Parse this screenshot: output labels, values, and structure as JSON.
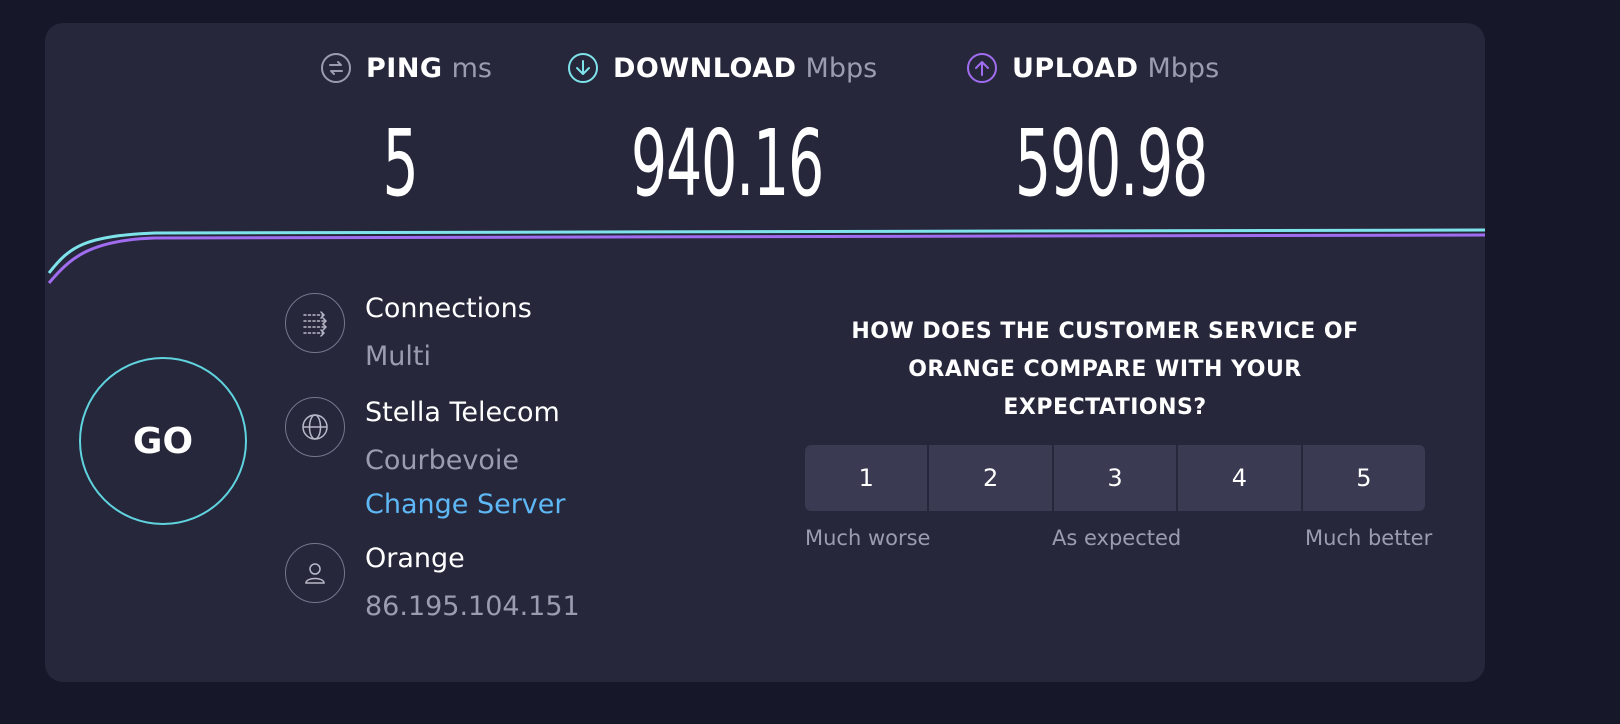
{
  "metrics": {
    "ping": {
      "label": "PING",
      "unit": "ms",
      "value": "5",
      "icon": "ping-icon"
    },
    "download": {
      "label": "DOWNLOAD",
      "unit": "Mbps",
      "value": "940.16",
      "icon": "download-icon"
    },
    "upload": {
      "label": "UPLOAD",
      "unit": "Mbps",
      "value": "590.98",
      "icon": "upload-icon"
    }
  },
  "go_button": {
    "label": "GO"
  },
  "connections": {
    "title": "Connections",
    "value": "Multi",
    "icon": "connections-icon"
  },
  "server": {
    "name": "Stella Telecom",
    "location": "Courbevoie",
    "change_label": "Change Server",
    "icon": "globe-icon"
  },
  "provider": {
    "name": "Orange",
    "ip": "86.195.104.151",
    "icon": "user-icon"
  },
  "survey": {
    "question": "HOW DOES THE CUSTOMER SERVICE OF ORANGE COMPARE WITH YOUR EXPECTATIONS?",
    "ratings": [
      "1",
      "2",
      "3",
      "4",
      "5"
    ],
    "scale": {
      "low": "Much worse",
      "mid": "As expected",
      "high": "Much better"
    }
  },
  "colors": {
    "download_line": "#7fe3ec",
    "upload_line": "#a06cf0",
    "go_ring": "#5fd3de",
    "link": "#5eb8f5"
  }
}
